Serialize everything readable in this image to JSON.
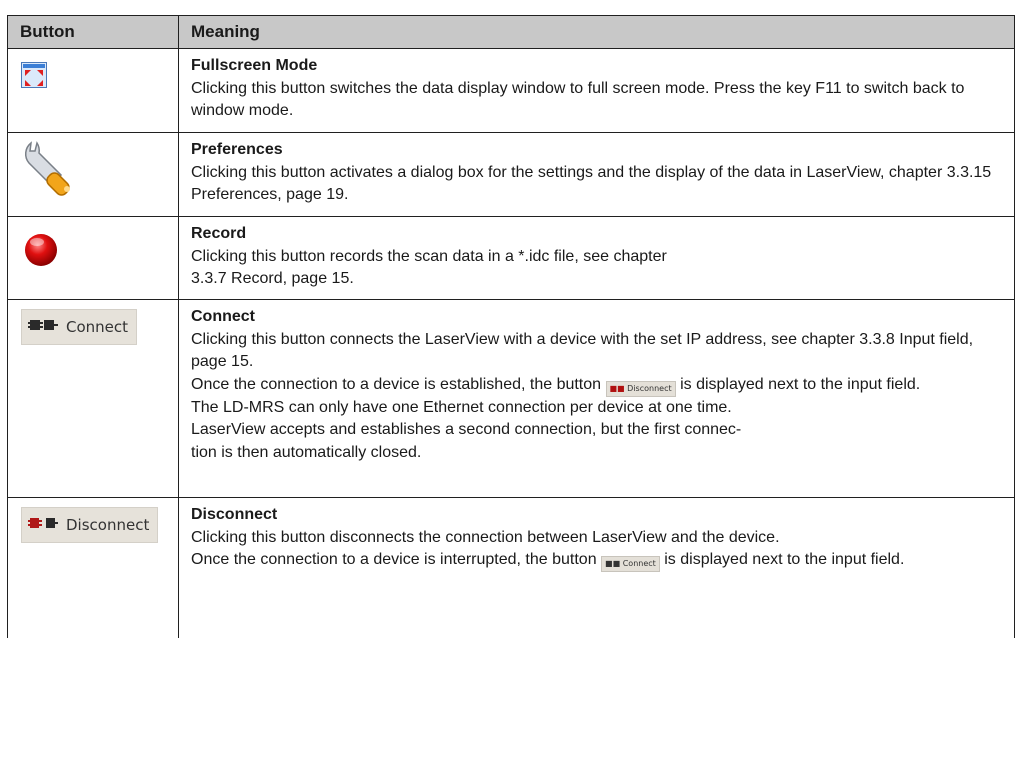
{
  "table": {
    "headers": {
      "button": "Button",
      "meaning": "Meaning"
    },
    "rows": [
      {
        "icon": "fullscreen-icon",
        "title": "Fullscreen Mode",
        "lines": [
          "Clicking this button switches the data display window to full screen mode. Press the key F11 to switch back to window mode."
        ]
      },
      {
        "icon": "wrench-icon",
        "title": "Preferences",
        "lines": [
          "Clicking this button activates a dialog box for the settings and the display of the data in LaserView, chapter 3.3.15 Preferences, page 19."
        ]
      },
      {
        "icon": "record-icon",
        "title": "Record",
        "lines": [
          "Clicking this button records the scan data in a *.idc file, see chapter",
          "3.3.7 Record, page 15."
        ]
      },
      {
        "icon": "connect-icon",
        "button_label": "Connect",
        "title": "Connect",
        "line1": "Clicking this button connects the LaserView with a device with the set IP address, see chapter 3.3.8 Input field, page 15.",
        "line2_pre": "Once the connection to a device is established, the button",
        "inline_button_label": "Disconnect",
        "line2_post": "is displayed next to the input field.",
        "line3": "The LD-MRS can only have one Ethernet connection per device at one time.",
        "line4": "LaserView accepts and establishes a second connection, but the first connec-",
        "line5": "tion is then automatically closed."
      },
      {
        "icon": "disconnect-icon",
        "button_label": "Disconnect",
        "title": "Disconnect",
        "line1": "Clicking this button disconnects the connection between LaserView and the device.",
        "line2_pre": "Once the connection to a device is interrupted, the button",
        "inline_button_label": "Connect",
        "line2_post": "is displayed next to the input field."
      }
    ]
  }
}
